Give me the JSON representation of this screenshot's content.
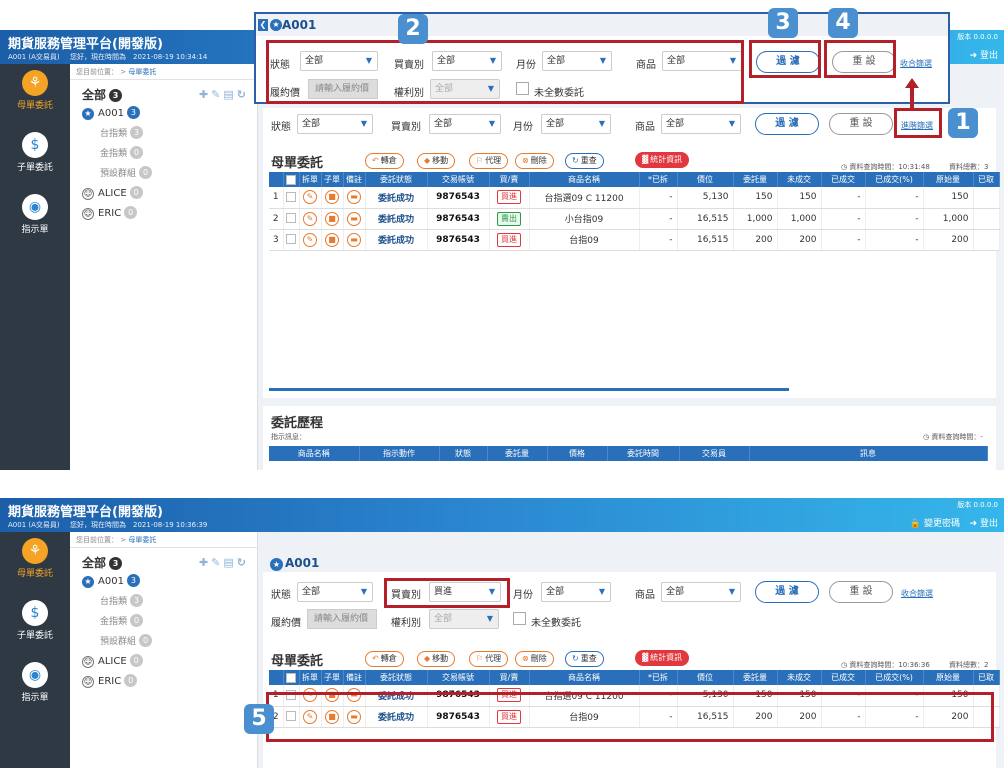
{
  "header": {
    "app_title": "期貨服務管理平台(開發版)",
    "account": "A001 (A交易員)",
    "greeting_1": "您好，現在時間為　2021-08-19 10:34:14",
    "greeting_2": "您好，現在時間為　2021-08-19 10:36:39",
    "version": "版本 0.0.0.0",
    "logout": "登出",
    "change_password": "變更密碼"
  },
  "sidenav": {
    "items": [
      {
        "label": "母單委託",
        "icon": "order-icon"
      },
      {
        "label": "子單委託",
        "icon": "child-order-icon"
      },
      {
        "label": "指示單",
        "icon": "instruction-icon"
      }
    ]
  },
  "breadcrumb": {
    "prefix": "您目前位置： >",
    "current": "母單委託"
  },
  "tree": {
    "root_label": "全部",
    "root_count": "3",
    "account": "A001",
    "account_count": "3",
    "groups": [
      {
        "label": "台指類",
        "count": "3"
      },
      {
        "label": "金指類",
        "count": "0"
      },
      {
        "label": "預設群組",
        "count": "0"
      }
    ],
    "users": [
      {
        "label": "ALICE",
        "count": "0"
      },
      {
        "label": "ERIC",
        "count": "0"
      }
    ]
  },
  "popup": {
    "title": "A001"
  },
  "filter": {
    "status_label": "狀態",
    "status_value": "全部",
    "side_label": "買賣別",
    "side_value": "全部",
    "side_value_2": "買進",
    "month_label": "月份",
    "month_value": "全部",
    "product_label": "商品",
    "product_value": "全部",
    "strike_label": "履約價",
    "strike_placeholder": "請輸入履約價",
    "right_label": "權利別",
    "right_value": "全部",
    "untraded_label": "未全數委託",
    "filter_button": "過 濾",
    "reset_button": "重 設",
    "advanced_link": "進階篩選",
    "collapse_link": "收合篩選"
  },
  "orders": {
    "title": "母單委託",
    "actions": [
      {
        "label": "轉倉",
        "icon": "transfer-icon"
      },
      {
        "label": "移動",
        "icon": "move-icon"
      },
      {
        "label": "代理",
        "icon": "proxy-icon"
      },
      {
        "label": "刪除",
        "icon": "delete-icon"
      },
      {
        "label": "重查",
        "icon": "refresh-icon"
      }
    ],
    "stats": "統計資訊",
    "query_time_1": "資料查詢時間：10:31:48",
    "total_1": "資料總數：3",
    "query_time_2": "資料查詢時間：10:36:36",
    "total_2": "資料總數：2",
    "columns": [
      "",
      "",
      "拆單",
      "子單",
      "備註",
      "委託狀態",
      "交易帳號",
      "買/賣",
      "商品名稱",
      "*已拆",
      "價位",
      "委託量",
      "未成交",
      "已成交",
      "已成交(%)",
      "原始量",
      "已取"
    ],
    "rows": [
      {
        "no": "1",
        "status": "委託成功",
        "account": "9876543",
        "side": "買進",
        "side_type": "buy",
        "product": "台指選09 C 11200",
        "split": "-",
        "price": "5,130",
        "qty": "150",
        "open": "150",
        "filled": "-",
        "pct": "-",
        "orig": "150"
      },
      {
        "no": "2",
        "status": "委託成功",
        "account": "9876543",
        "side": "賣出",
        "side_type": "sell",
        "product": "小台指09",
        "split": "-",
        "price": "16,515",
        "qty": "1,000",
        "open": "1,000",
        "filled": "-",
        "pct": "-",
        "orig": "1,000"
      },
      {
        "no": "3",
        "status": "委託成功",
        "account": "9876543",
        "side": "買進",
        "side_type": "buy",
        "product": "台指09",
        "split": "-",
        "price": "16,515",
        "qty": "200",
        "open": "200",
        "filled": "-",
        "pct": "-",
        "orig": "200"
      }
    ],
    "filtered_rows": [
      {
        "no": "1",
        "status": "委託成功",
        "account": "9876543",
        "side": "買進",
        "side_type": "buy",
        "product": "台指選09 C 11200",
        "split": "-",
        "price": "5,130",
        "qty": "150",
        "open": "150",
        "filled": "-",
        "pct": "-",
        "orig": "150"
      },
      {
        "no": "2",
        "status": "委託成功",
        "account": "9876543",
        "side": "買進",
        "side_type": "buy",
        "product": "台指09",
        "split": "-",
        "price": "16,515",
        "qty": "200",
        "open": "200",
        "filled": "-",
        "pct": "-",
        "orig": "200"
      }
    ]
  },
  "history": {
    "title": "委託歷程",
    "message_label": "指示訊息：",
    "query_time": "資料查詢時間：-",
    "columns": [
      "商品名稱",
      "指示動作",
      "狀態",
      "委託量",
      "價格",
      "委託時間",
      "交易員",
      "訊息"
    ]
  },
  "steps": [
    "1",
    "2",
    "3",
    "4",
    "5"
  ],
  "colors": {
    "primary": "#2a6fb9",
    "nav_bg": "#2f3944",
    "accent_orange": "#f4a324",
    "annotation_red": "#b3202a",
    "annotation_blue": "#2d5fa8"
  }
}
